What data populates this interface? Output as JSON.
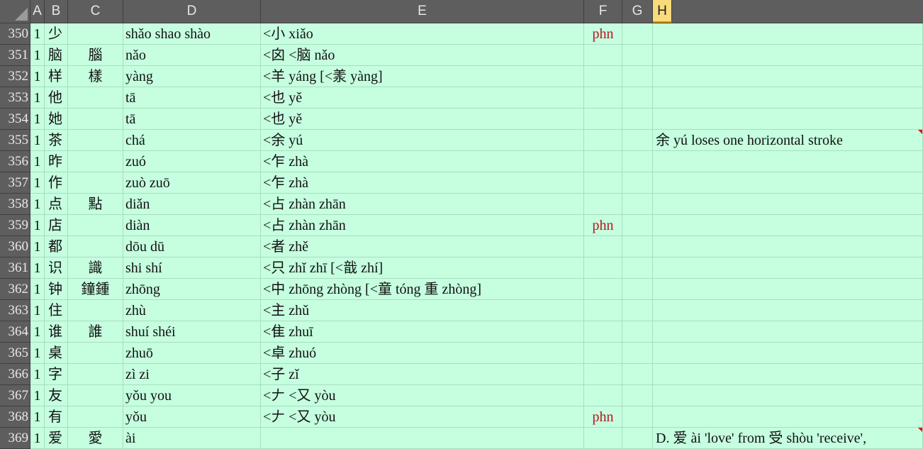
{
  "columns": [
    "A",
    "B",
    "C",
    "D",
    "E",
    "F",
    "G",
    "H"
  ],
  "active_column": "H",
  "rows": [
    {
      "num": "350",
      "a": "1",
      "b": "少",
      "c": "",
      "d": "shǎo shao shào",
      "e": "<小 xiǎo",
      "f": "phn",
      "h": ""
    },
    {
      "num": "351",
      "a": "1",
      "b": "脑",
      "c": "腦",
      "d": "nǎo",
      "e": "<囟 <脑 nǎo",
      "f": "",
      "h": ""
    },
    {
      "num": "352",
      "a": "1",
      "b": "样",
      "c": "樣",
      "d": "yàng",
      "e": "<羊 yáng [<羕 yàng]",
      "f": "",
      "h": ""
    },
    {
      "num": "353",
      "a": "1",
      "b": "他",
      "c": "",
      "d": "tā",
      "e": "<也 yě",
      "f": "",
      "h": ""
    },
    {
      "num": "354",
      "a": "1",
      "b": "她",
      "c": "",
      "d": "tā",
      "e": "<也 yě",
      "f": "",
      "h": ""
    },
    {
      "num": "355",
      "a": "1",
      "b": "茶",
      "c": "",
      "d": "chá",
      "e": "<余 yú",
      "f": "",
      "h": "余 yú loses one horizontal stroke",
      "comment": true
    },
    {
      "num": "356",
      "a": "1",
      "b": "昨",
      "c": "",
      "d": "zuó",
      "e": "<乍 zhà",
      "f": "",
      "h": ""
    },
    {
      "num": "357",
      "a": "1",
      "b": "作",
      "c": "",
      "d": "zuò zuō",
      "e": "<乍 zhà",
      "f": "",
      "h": ""
    },
    {
      "num": "358",
      "a": "1",
      "b": "点",
      "c": "點",
      "d": "diǎn",
      "e": "<占 zhàn zhān",
      "f": "",
      "h": ""
    },
    {
      "num": "359",
      "a": "1",
      "b": "店",
      "c": "",
      "d": "diàn",
      "e": "<占 zhàn zhān",
      "f": "phn",
      "h": ""
    },
    {
      "num": "360",
      "a": "1",
      "b": "都",
      "c": "",
      "d": "dōu dū",
      "e": "<者 zhě",
      "f": "",
      "h": ""
    },
    {
      "num": "361",
      "a": "1",
      "b": "识",
      "c": "識",
      "d": "shi shí",
      "e": "<只 zhǐ zhī [<戠 zhí]",
      "f": "",
      "h": ""
    },
    {
      "num": "362",
      "a": "1",
      "b": "钟",
      "c": "鐘鍾",
      "d": "zhōng",
      "e": "<中 zhōng zhòng [<童 tóng 重 zhòng]",
      "f": "",
      "h": ""
    },
    {
      "num": "363",
      "a": "1",
      "b": "住",
      "c": "",
      "d": "zhù",
      "e": "<主 zhǔ",
      "f": "",
      "h": ""
    },
    {
      "num": "364",
      "a": "1",
      "b": "谁",
      "c": "誰",
      "d": "shuí shéi",
      "e": "<隹 zhuī",
      "f": "",
      "h": ""
    },
    {
      "num": "365",
      "a": "1",
      "b": "桌",
      "c": "",
      "d": "zhuō",
      "e": "<卓 zhuó",
      "f": "",
      "h": ""
    },
    {
      "num": "366",
      "a": "1",
      "b": "字",
      "c": "",
      "d": "zì zi",
      "e": "<子 zǐ",
      "f": "",
      "h": ""
    },
    {
      "num": "367",
      "a": "1",
      "b": "友",
      "c": "",
      "d": "yǒu you",
      "e": "<𠂇 <又 yòu",
      "f": "",
      "h": ""
    },
    {
      "num": "368",
      "a": "1",
      "b": "有",
      "c": "",
      "d": "yǒu",
      "e": "<𠂇 <又 yòu",
      "f": "phn",
      "h": ""
    },
    {
      "num": "369",
      "a": "1",
      "b": "爱",
      "c": "愛",
      "d": "ài",
      "e": "",
      "f": "",
      "h": "D. 爱 ài 'love' from 受 shòu 'receive',",
      "comment": true
    }
  ]
}
